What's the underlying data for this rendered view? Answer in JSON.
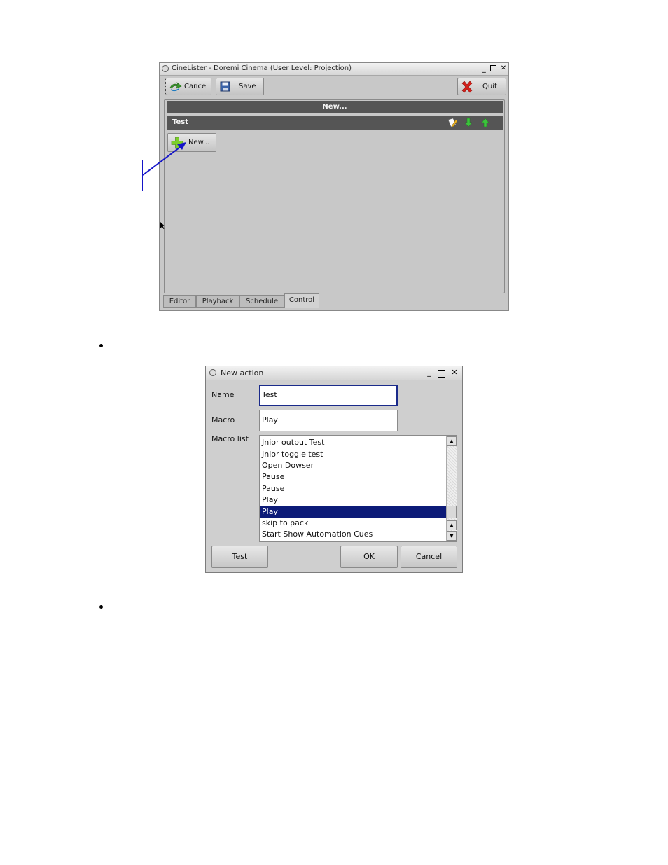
{
  "window": {
    "title": "CineLister - Doremi Cinema (User Level: Projection)",
    "minimize": "_",
    "close": "✕"
  },
  "toolbar": {
    "cancel_label": "Cancel",
    "save_label": "Save",
    "quit_label": "Quit"
  },
  "panel": {
    "header": "New...",
    "item_name": "Test",
    "new_button_label": "New..."
  },
  "tabs": [
    {
      "label": "Editor"
    },
    {
      "label": "Playback"
    },
    {
      "label": "Schedule"
    },
    {
      "label": "Control",
      "active": true
    }
  ],
  "dialog": {
    "title": "New action",
    "minimize": "_",
    "close": "✕",
    "name_label": "Name",
    "name_value": "Test",
    "macro_label": "Macro",
    "macro_value": "Play",
    "macro_list_label": "Macro list",
    "macro_list": [
      {
        "label": "Jnior output Test",
        "selected": false
      },
      {
        "label": "Jnior toggle test",
        "selected": false
      },
      {
        "label": "Open Dowser",
        "selected": false
      },
      {
        "label": "Pause",
        "selected": false
      },
      {
        "label": "Pause",
        "selected": false
      },
      {
        "label": "Play",
        "selected": false
      },
      {
        "label": "Play",
        "selected": true
      },
      {
        "label": "skip to pack",
        "selected": false
      },
      {
        "label": "Start Show Automation Cues",
        "selected": false
      }
    ],
    "test_button": "Test",
    "ok_button": "OK",
    "cancel_button": "Cancel"
  },
  "colors": {
    "accent_dark_bar": "#555555",
    "selection": "#0c1b78",
    "callout_border": "#1515c8"
  }
}
